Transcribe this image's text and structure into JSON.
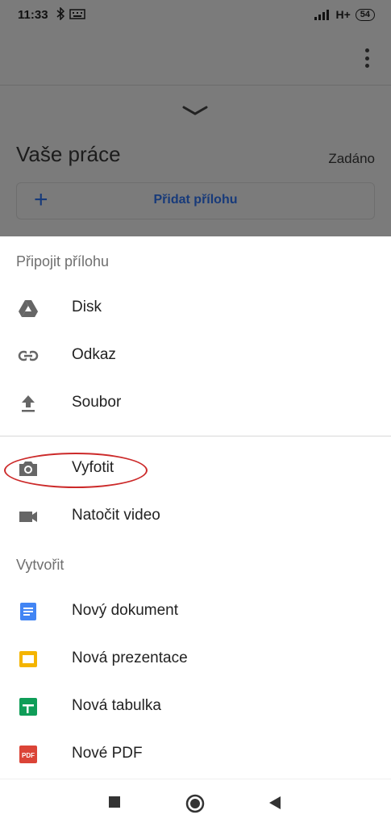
{
  "status": {
    "time": "11:33",
    "network": "H+",
    "battery": "54"
  },
  "background": {
    "section_title": "Vaše práce",
    "status": "Zadáno",
    "add_button_label": "Přidat přílohu"
  },
  "attach": {
    "title": "Připojit přílohu",
    "items": [
      {
        "label": "Disk",
        "icon": "drive-icon"
      },
      {
        "label": "Odkaz",
        "icon": "link-icon"
      },
      {
        "label": "Soubor",
        "icon": "upload-icon"
      },
      {
        "label": "Vyfotit",
        "icon": "camera-icon"
      },
      {
        "label": "Natočit video",
        "icon": "video-icon"
      }
    ]
  },
  "create": {
    "title": "Vytvořit",
    "items": [
      {
        "label": "Nový dokument",
        "icon": "docs-icon",
        "color": "#4285f4"
      },
      {
        "label": "Nová prezentace",
        "icon": "slides-icon",
        "color": "#f4b400"
      },
      {
        "label": "Nová tabulka",
        "icon": "sheets-icon",
        "color": "#0f9d58"
      },
      {
        "label": "Nové PDF",
        "icon": "pdf-icon",
        "color": "#db4437",
        "icon_text": "PDF"
      }
    ]
  },
  "colors": {
    "accent_blue": "#173a7a",
    "highlight_red": "#cc2a2a"
  }
}
